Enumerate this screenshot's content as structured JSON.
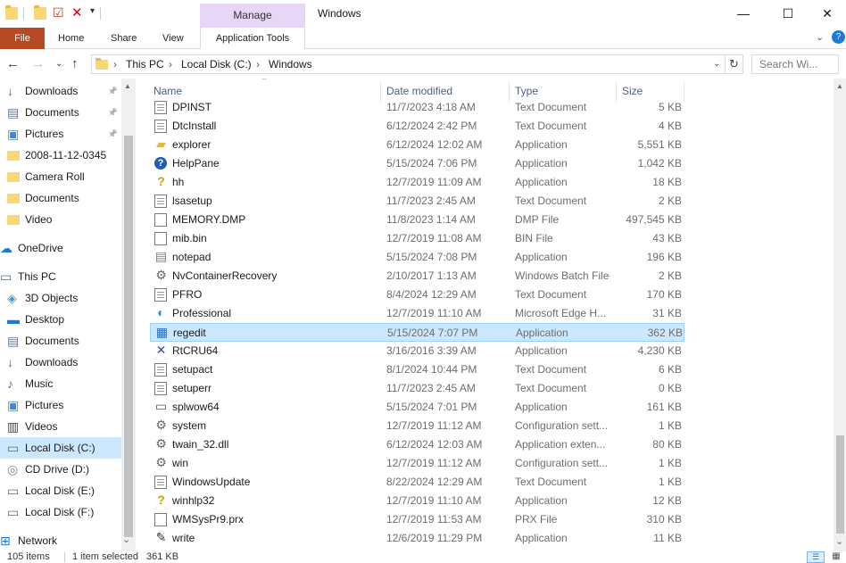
{
  "window": {
    "title": "Windows",
    "minimize": "—",
    "maximize": "☐",
    "close": "✕"
  },
  "ribbon": {
    "file": "File",
    "home": "Home",
    "share": "Share",
    "view": "View",
    "manage": "Manage",
    "application_tools": "Application Tools"
  },
  "address": {
    "crumbs": [
      "This PC",
      "Local Disk (C:)",
      "Windows"
    ],
    "search_placeholder": "Search Wi..."
  },
  "sidebar": {
    "items": [
      {
        "label": "Downloads",
        "icon": "download-arrow-icon",
        "pinned": true
      },
      {
        "label": "Documents",
        "icon": "documents-icon",
        "pinned": true
      },
      {
        "label": "Pictures",
        "icon": "pictures-icon",
        "pinned": true
      },
      {
        "label": "2008-11-12-0345",
        "icon": "folder-icon",
        "pinned": false
      },
      {
        "label": "Camera Roll",
        "icon": "folder-icon",
        "pinned": false
      },
      {
        "label": "Documents",
        "icon": "folder-icon",
        "pinned": false
      },
      {
        "label": "Video",
        "icon": "folder-icon",
        "pinned": false
      },
      {
        "label": "OneDrive",
        "icon": "cloud-icon",
        "pinned": false
      },
      {
        "label": "This PC",
        "icon": "computer-icon",
        "pinned": false
      },
      {
        "label": "3D Objects",
        "icon": "cube-icon",
        "pinned": false
      },
      {
        "label": "Desktop",
        "icon": "desktop-icon",
        "pinned": false
      },
      {
        "label": "Documents",
        "icon": "documents-icon",
        "pinned": false
      },
      {
        "label": "Downloads",
        "icon": "download-arrow-icon",
        "pinned": false
      },
      {
        "label": "Music",
        "icon": "music-note-icon",
        "pinned": false
      },
      {
        "label": "Pictures",
        "icon": "pictures-icon",
        "pinned": false
      },
      {
        "label": "Videos",
        "icon": "film-icon",
        "pinned": false
      },
      {
        "label": "Local Disk (C:)",
        "icon": "drive-icon",
        "pinned": false
      },
      {
        "label": "CD Drive (D:)",
        "icon": "cd-icon",
        "pinned": false
      },
      {
        "label": "Local Disk (E:)",
        "icon": "drive-icon",
        "pinned": false
      },
      {
        "label": "Local Disk (F:)",
        "icon": "drive-icon",
        "pinned": false
      },
      {
        "label": "Network",
        "icon": "network-icon",
        "pinned": false
      }
    ],
    "pin_glyph": "📌"
  },
  "columns": {
    "name": "Name",
    "date": "Date modified",
    "type": "Type",
    "size": "Size"
  },
  "files": [
    {
      "name": "DPINST",
      "date": "11/7/2023 4:18 AM",
      "type": "Text Document",
      "size": "5 KB",
      "icon": "doc"
    },
    {
      "name": "DtcInstall",
      "date": "6/12/2024 2:42 PM",
      "type": "Text Document",
      "size": "4 KB",
      "icon": "doc"
    },
    {
      "name": "explorer",
      "date": "6/12/2024 12:02 AM",
      "type": "Application",
      "size": "5,551 KB",
      "icon": "folder"
    },
    {
      "name": "HelpPane",
      "date": "5/15/2024 7:06 PM",
      "type": "Application",
      "size": "1,042 KB",
      "icon": "help"
    },
    {
      "name": "hh",
      "date": "12/7/2019 11:09 AM",
      "type": "Application",
      "size": "18 KB",
      "icon": "hh"
    },
    {
      "name": "lsasetup",
      "date": "11/7/2023 2:45 AM",
      "type": "Text Document",
      "size": "2 KB",
      "icon": "doc"
    },
    {
      "name": "MEMORY.DMP",
      "date": "11/8/2023 1:14 AM",
      "type": "DMP File",
      "size": "497,545 KB",
      "icon": "blank"
    },
    {
      "name": "mib.bin",
      "date": "12/7/2019 11:08 AM",
      "type": "BIN File",
      "size": "43 KB",
      "icon": "blank"
    },
    {
      "name": "notepad",
      "date": "5/15/2024 7:08 PM",
      "type": "Application",
      "size": "196 KB",
      "icon": "notepad"
    },
    {
      "name": "NvContainerRecovery",
      "date": "2/10/2017 1:13 AM",
      "type": "Windows Batch File",
      "size": "2 KB",
      "icon": "gear"
    },
    {
      "name": "PFRO",
      "date": "8/4/2024 12:29 AM",
      "type": "Text Document",
      "size": "170 KB",
      "icon": "doc"
    },
    {
      "name": "Professional",
      "date": "12/7/2019 11:10 AM",
      "type": "Microsoft Edge H...",
      "size": "31 KB",
      "icon": "edge"
    },
    {
      "name": "regedit",
      "date": "5/15/2024 7:07 PM",
      "type": "Application",
      "size": "362 KB",
      "icon": "regedit"
    },
    {
      "name": "RtCRU64",
      "date": "3/16/2016 3:39 AM",
      "type": "Application",
      "size": "4,230 KB",
      "icon": "tool"
    },
    {
      "name": "setupact",
      "date": "8/1/2024 10:44 PM",
      "type": "Text Document",
      "size": "6 KB",
      "icon": "doc"
    },
    {
      "name": "setuperr",
      "date": "11/7/2023 2:45 AM",
      "type": "Text Document",
      "size": "0 KB",
      "icon": "doc"
    },
    {
      "name": "splwow64",
      "date": "5/15/2024 7:01 PM",
      "type": "Application",
      "size": "161 KB",
      "icon": "printer"
    },
    {
      "name": "system",
      "date": "12/7/2019 11:12 AM",
      "type": "Configuration sett...",
      "size": "1 KB",
      "icon": "gear"
    },
    {
      "name": "twain_32.dll",
      "date": "6/12/2024 12:03 AM",
      "type": "Application exten...",
      "size": "80 KB",
      "icon": "gear"
    },
    {
      "name": "win",
      "date": "12/7/2019 11:12 AM",
      "type": "Configuration sett...",
      "size": "1 KB",
      "icon": "gear"
    },
    {
      "name": "WindowsUpdate",
      "date": "8/22/2024 12:29 AM",
      "type": "Text Document",
      "size": "1 KB",
      "icon": "doc"
    },
    {
      "name": "winhlp32",
      "date": "12/7/2019 11:10 AM",
      "type": "Application",
      "size": "12 KB",
      "icon": "hh"
    },
    {
      "name": "WMSysPr9.prx",
      "date": "12/7/2019 11:53 AM",
      "type": "PRX File",
      "size": "310 KB",
      "icon": "blank"
    },
    {
      "name": "write",
      "date": "12/6/2019 11:29 PM",
      "type": "Application",
      "size": "11 KB",
      "icon": "write"
    }
  ],
  "selected_file": "regedit",
  "status": {
    "items": "105 items",
    "selected": "1 item selected",
    "size": "361 KB"
  },
  "colors": {
    "accent_file_tab": "#b54a23",
    "manage_tab": "#e7d6f5",
    "selection": "#cce8ff"
  }
}
